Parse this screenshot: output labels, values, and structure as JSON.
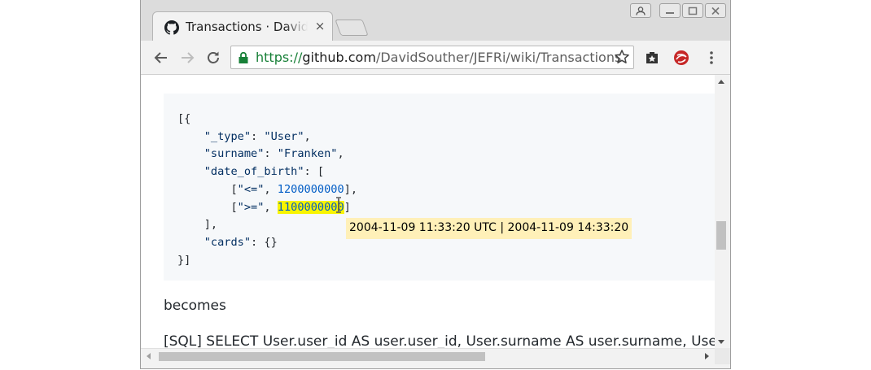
{
  "browser": {
    "tab_title": "Transactions · DavidSouther/JEFRi Wiki",
    "tab_close_symbol": "×",
    "url_scheme": "https://",
    "url_host": "github.com",
    "url_path": "/DavidSouther/JEFRi/wiki/Transactions"
  },
  "code_block": {
    "lines": [
      [
        {
          "t": "[{"
        }
      ],
      [
        {
          "t": "    "
        },
        {
          "t": "\"_type\"",
          "c": "s"
        },
        {
          "t": ": "
        },
        {
          "t": "\"User\"",
          "c": "s"
        },
        {
          "t": ","
        }
      ],
      [
        {
          "t": "    "
        },
        {
          "t": "\"surname\"",
          "c": "s"
        },
        {
          "t": ": "
        },
        {
          "t": "\"Franken\"",
          "c": "s"
        },
        {
          "t": ","
        }
      ],
      [
        {
          "t": "    "
        },
        {
          "t": "\"date_of_birth\"",
          "c": "s"
        },
        {
          "t": ": ["
        }
      ],
      [
        {
          "t": "        ["
        },
        {
          "t": "\"<=\"",
          "c": "s"
        },
        {
          "t": ", "
        },
        {
          "t": "1200000000",
          "c": "n"
        },
        {
          "t": "],"
        }
      ],
      [
        {
          "t": "        ["
        },
        {
          "t": "\">=\"",
          "c": "s"
        },
        {
          "t": ", "
        },
        {
          "t": "1100000000",
          "c": "hl"
        },
        {
          "t": "]"
        }
      ],
      [
        {
          "t": "    ],"
        }
      ],
      [
        {
          "t": "    "
        },
        {
          "t": "\"cards\"",
          "c": "s"
        },
        {
          "t": ": {}"
        }
      ],
      [
        {
          "t": "}]"
        }
      ]
    ]
  },
  "tooltip": {
    "text": "2004-11-09 11:33:20 UTC | 2004-11-09 14:33:20"
  },
  "content": {
    "becomes": "becomes",
    "sql_line": "[SQL] SELECT User.user_id AS user.user_id, User.surname AS user.surname, User.date_of_birth"
  },
  "colors": {
    "highlight": "#f8f400",
    "tooltip_bg": "#fff0b8",
    "code_bg": "#f6f8fa",
    "secure_green": "#188038"
  },
  "icons": {
    "tab_favicon": "github-icon",
    "back": "back-arrow-icon",
    "forward": "forward-arrow-icon",
    "reload": "reload-icon",
    "secure": "lock-icon",
    "bookmark": "star-icon",
    "ext1": "extension-puzzle-icon",
    "ext2": "extension-swirl-icon",
    "menu": "kebab-menu-icon"
  }
}
